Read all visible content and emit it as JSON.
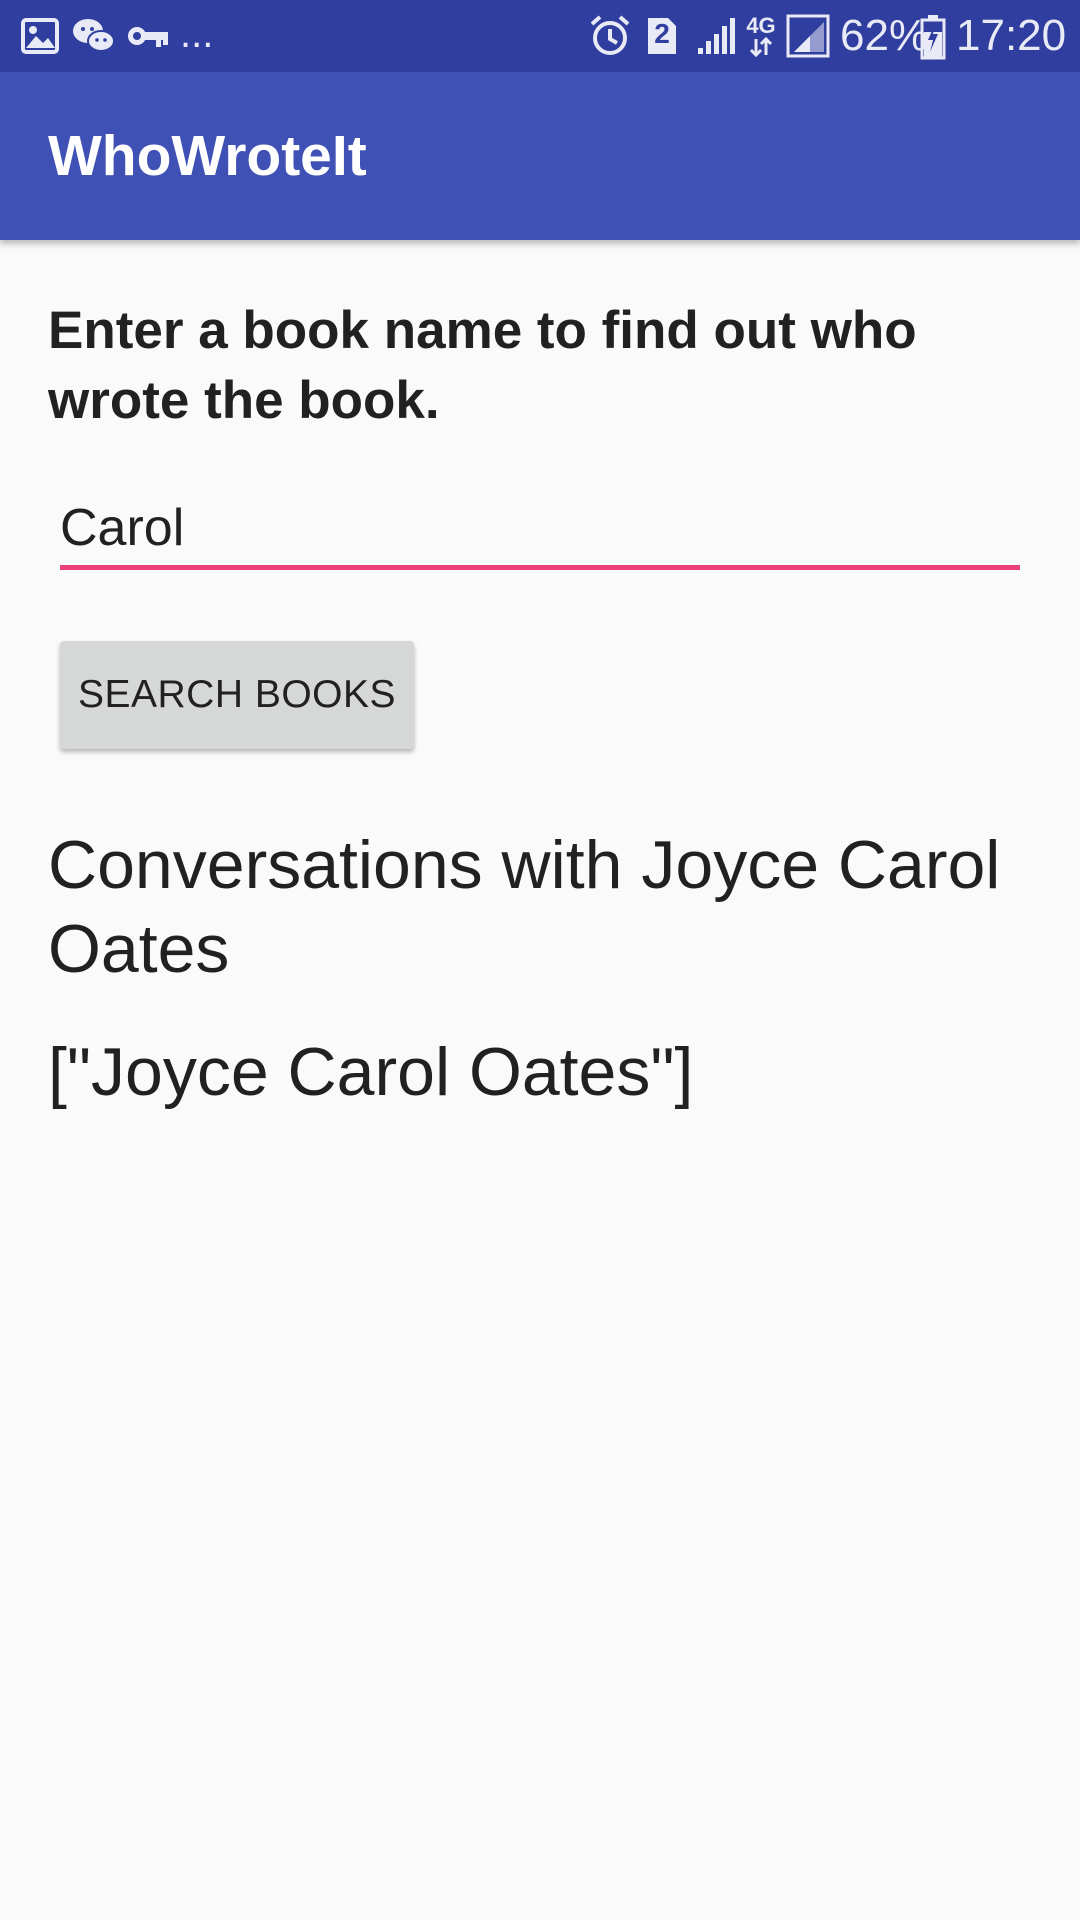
{
  "status_bar": {
    "notification_icons": [
      "image-icon",
      "wechat-icon",
      "key-icon"
    ],
    "overflow": "...",
    "system_icons": [
      "alarm-icon",
      "sim-2-icon",
      "signal-icon",
      "network-4g-icon",
      "signal-icon"
    ],
    "sim_label": "2",
    "network_label": "4G",
    "battery_percent": "62%",
    "time": "17:20"
  },
  "app_bar": {
    "title": "WhoWroteIt"
  },
  "main": {
    "instruction": "Enter a book name to find out who wrote the book.",
    "search_input": {
      "value": "Carol",
      "placeholder": ""
    },
    "search_button_label": "SEARCH BOOKS",
    "result_title": "Conversations with Joyce Carol Oates",
    "result_authors": "[\"Joyce Carol Oates\"]"
  },
  "colors": {
    "status_bar": "#303f9f",
    "app_bar": "#3f51b5",
    "accent": "#ec407a",
    "background": "#fafafa",
    "button": "#d6d7d7",
    "text": "#212121"
  }
}
